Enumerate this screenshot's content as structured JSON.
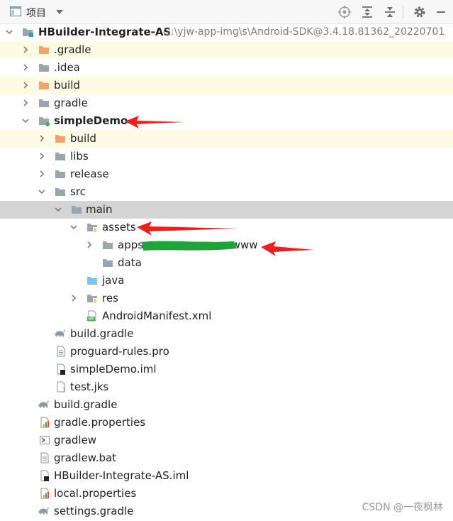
{
  "toolbar": {
    "title": "项目",
    "icons": [
      "project-view-icon",
      "dropdown-icon",
      "locate-icon",
      "expand-all-icon",
      "collapse-all-icon",
      "gear-icon",
      "minimize-icon"
    ]
  },
  "tree": {
    "root": {
      "label": "HBuilder-Integrate-AS",
      "path": "G:\\yjw-app-img\\s\\Android-SDK@3.4.18.81362_20220701"
    },
    "items": [
      {
        "label": ".gradle"
      },
      {
        "label": ".idea"
      },
      {
        "label": "build"
      },
      {
        "label": "gradle"
      },
      {
        "label": "simpleDemo"
      },
      {
        "label": "build"
      },
      {
        "label": "libs"
      },
      {
        "label": "release"
      },
      {
        "label": "src"
      },
      {
        "label": "main"
      },
      {
        "label": "assets"
      },
      {
        "label": "apps",
        "label_suffix": ".www"
      },
      {
        "label": "data"
      },
      {
        "label": "java"
      },
      {
        "label": "res"
      },
      {
        "label": "AndroidManifest.xml",
        "badge": "MF"
      },
      {
        "label": "build.gradle"
      },
      {
        "label": "proguard-rules.pro"
      },
      {
        "label": "simpleDemo.iml"
      },
      {
        "label": "test.jks"
      },
      {
        "label": "build.gradle"
      },
      {
        "label": "gradle.properties"
      },
      {
        "label": "gradlew"
      },
      {
        "label": "gradlew.bat"
      },
      {
        "label": "HBuilder-Integrate-AS.iml"
      },
      {
        "label": "local.properties"
      },
      {
        "label": "settings.gradle"
      }
    ]
  },
  "watermark": "CSDN @一夜枫林",
  "colors": {
    "folder_gray": "#9aa5ad",
    "folder_orange": "#f0a36a",
    "folder_blue": "#7ec3ea",
    "arrow_red": "#e8231f",
    "redaction_green": "#1fa33a",
    "row_highlight_yellow": "#fdfbe3",
    "row_selected_gray": "#d4d4d4"
  }
}
